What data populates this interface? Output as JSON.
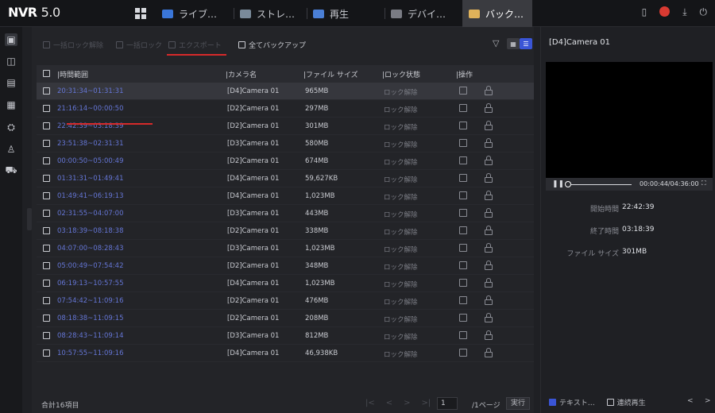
{
  "app": {
    "logo_main": "NVR",
    "logo_version": "5.0"
  },
  "tabs": [
    {
      "label": "ライブ…",
      "icon": "live-view-icon",
      "color": "#3a76d9"
    },
    {
      "label": "ストレ…",
      "icon": "storage-icon",
      "color": "#7a8a9a"
    },
    {
      "label": "再生",
      "icon": "playback-icon",
      "color": "#4a7fd6"
    },
    {
      "label": "デバイ…",
      "icon": "device-icon",
      "color": "#7a7c84"
    },
    {
      "label": "バック…",
      "icon": "backup-folder-icon",
      "color": "#e0b25a"
    }
  ],
  "toolbar": {
    "unlock_label": "一括ロック解除",
    "lock_label": "一括ロック",
    "export_label": "エクスポート",
    "backup_all_label": "全てバックアップ"
  },
  "table": {
    "headers": [
      "時間範囲",
      "カメラ名",
      "ファイル サイズ",
      "ロック状態",
      "操作"
    ],
    "rows": [
      {
        "time": "20:31:34~01:31:31",
        "camera": "[D4]Camera 01",
        "size": "965MB",
        "lock": "ロック解除"
      },
      {
        "time": "21:16:14~00:00:50",
        "camera": "[D2]Camera 01",
        "size": "297MB",
        "lock": "ロック解除"
      },
      {
        "time": "22:42:39~03:18:39",
        "camera": "[D2]Camera 01",
        "size": "301MB",
        "lock": "ロック解除"
      },
      {
        "time": "23:51:38~02:31:31",
        "camera": "[D3]Camera 01",
        "size": "580MB",
        "lock": "ロック解除"
      },
      {
        "time": "00:00:50~05:00:49",
        "camera": "[D2]Camera 01",
        "size": "674MB",
        "lock": "ロック解除"
      },
      {
        "time": "01:31:31~01:49:41",
        "camera": "[D4]Camera 01",
        "size": "59,627KB",
        "lock": "ロック解除"
      },
      {
        "time": "01:49:41~06:19:13",
        "camera": "[D4]Camera 01",
        "size": "1,023MB",
        "lock": "ロック解除"
      },
      {
        "time": "02:31:55~04:07:00",
        "camera": "[D3]Camera 01",
        "size": "443MB",
        "lock": "ロック解除"
      },
      {
        "time": "03:18:39~08:18:38",
        "camera": "[D2]Camera 01",
        "size": "338MB",
        "lock": "ロック解除"
      },
      {
        "time": "04:07:00~08:28:43",
        "camera": "[D3]Camera 01",
        "size": "1,023MB",
        "lock": "ロック解除"
      },
      {
        "time": "05:00:49~07:54:42",
        "camera": "[D2]Camera 01",
        "size": "348MB",
        "lock": "ロック解除"
      },
      {
        "time": "06:19:13~10:57:55",
        "camera": "[D4]Camera 01",
        "size": "1,023MB",
        "lock": "ロック解除"
      },
      {
        "time": "07:54:42~11:09:16",
        "camera": "[D2]Camera 01",
        "size": "476MB",
        "lock": "ロック解除"
      },
      {
        "time": "08:18:38~11:09:15",
        "camera": "[D2]Camera 01",
        "size": "208MB",
        "lock": "ロック解除"
      },
      {
        "time": "08:28:43~11:09:14",
        "camera": "[D3]Camera 01",
        "size": "812MB",
        "lock": "ロック解除"
      },
      {
        "time": "10:57:55~11:09:16",
        "camera": "[D4]Camera 01",
        "size": "46,938KB",
        "lock": "ロック解除"
      }
    ]
  },
  "footer": {
    "total": "合計16項目",
    "page_input": "1",
    "page_total": "/1ページ",
    "go_label": "実行"
  },
  "preview": {
    "camera_title": "[D4]Camera 01",
    "video_time": "00:00:44/04:36:00",
    "progress": 0.0,
    "start_key": "開始時間",
    "start_val": "22:42:39",
    "end_key": "終了時間",
    "end_val": "03:18:39",
    "size_key": "ファイル サイズ",
    "size_val": "301MB",
    "text_label": "テキスト…",
    "continuous_label": "連続再生"
  },
  "colors": {
    "accent": "#3a55d6",
    "time_link": "#6576d6",
    "highlight": "#d62a2a"
  }
}
